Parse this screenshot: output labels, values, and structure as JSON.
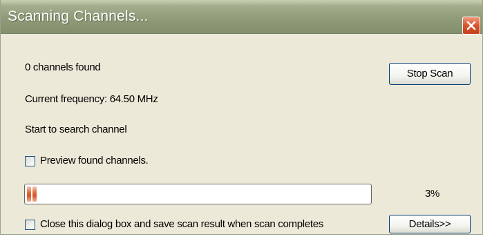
{
  "window": {
    "title": "Scanning Channels..."
  },
  "status": {
    "channels_found": "0 channels found",
    "current_frequency": "Current frequency: 64.50 MHz",
    "message": "Start to search channel"
  },
  "buttons": {
    "stop_scan": "Stop Scan",
    "details": "Details>>"
  },
  "options": {
    "preview_label": "Preview found channels.",
    "preview_checked": false,
    "close_on_complete_label": "Close this dialog box and save scan result when scan completes",
    "close_on_complete_checked": false
  },
  "progress": {
    "percent_label": "3%",
    "fraction": 0.03
  },
  "icons": {
    "close": "close-icon"
  },
  "colors": {
    "titlebar": "#8f9b79",
    "close_button": "#d9542c",
    "progress_fill": "#e06b3e",
    "dialog_background": "#ece9d8"
  }
}
